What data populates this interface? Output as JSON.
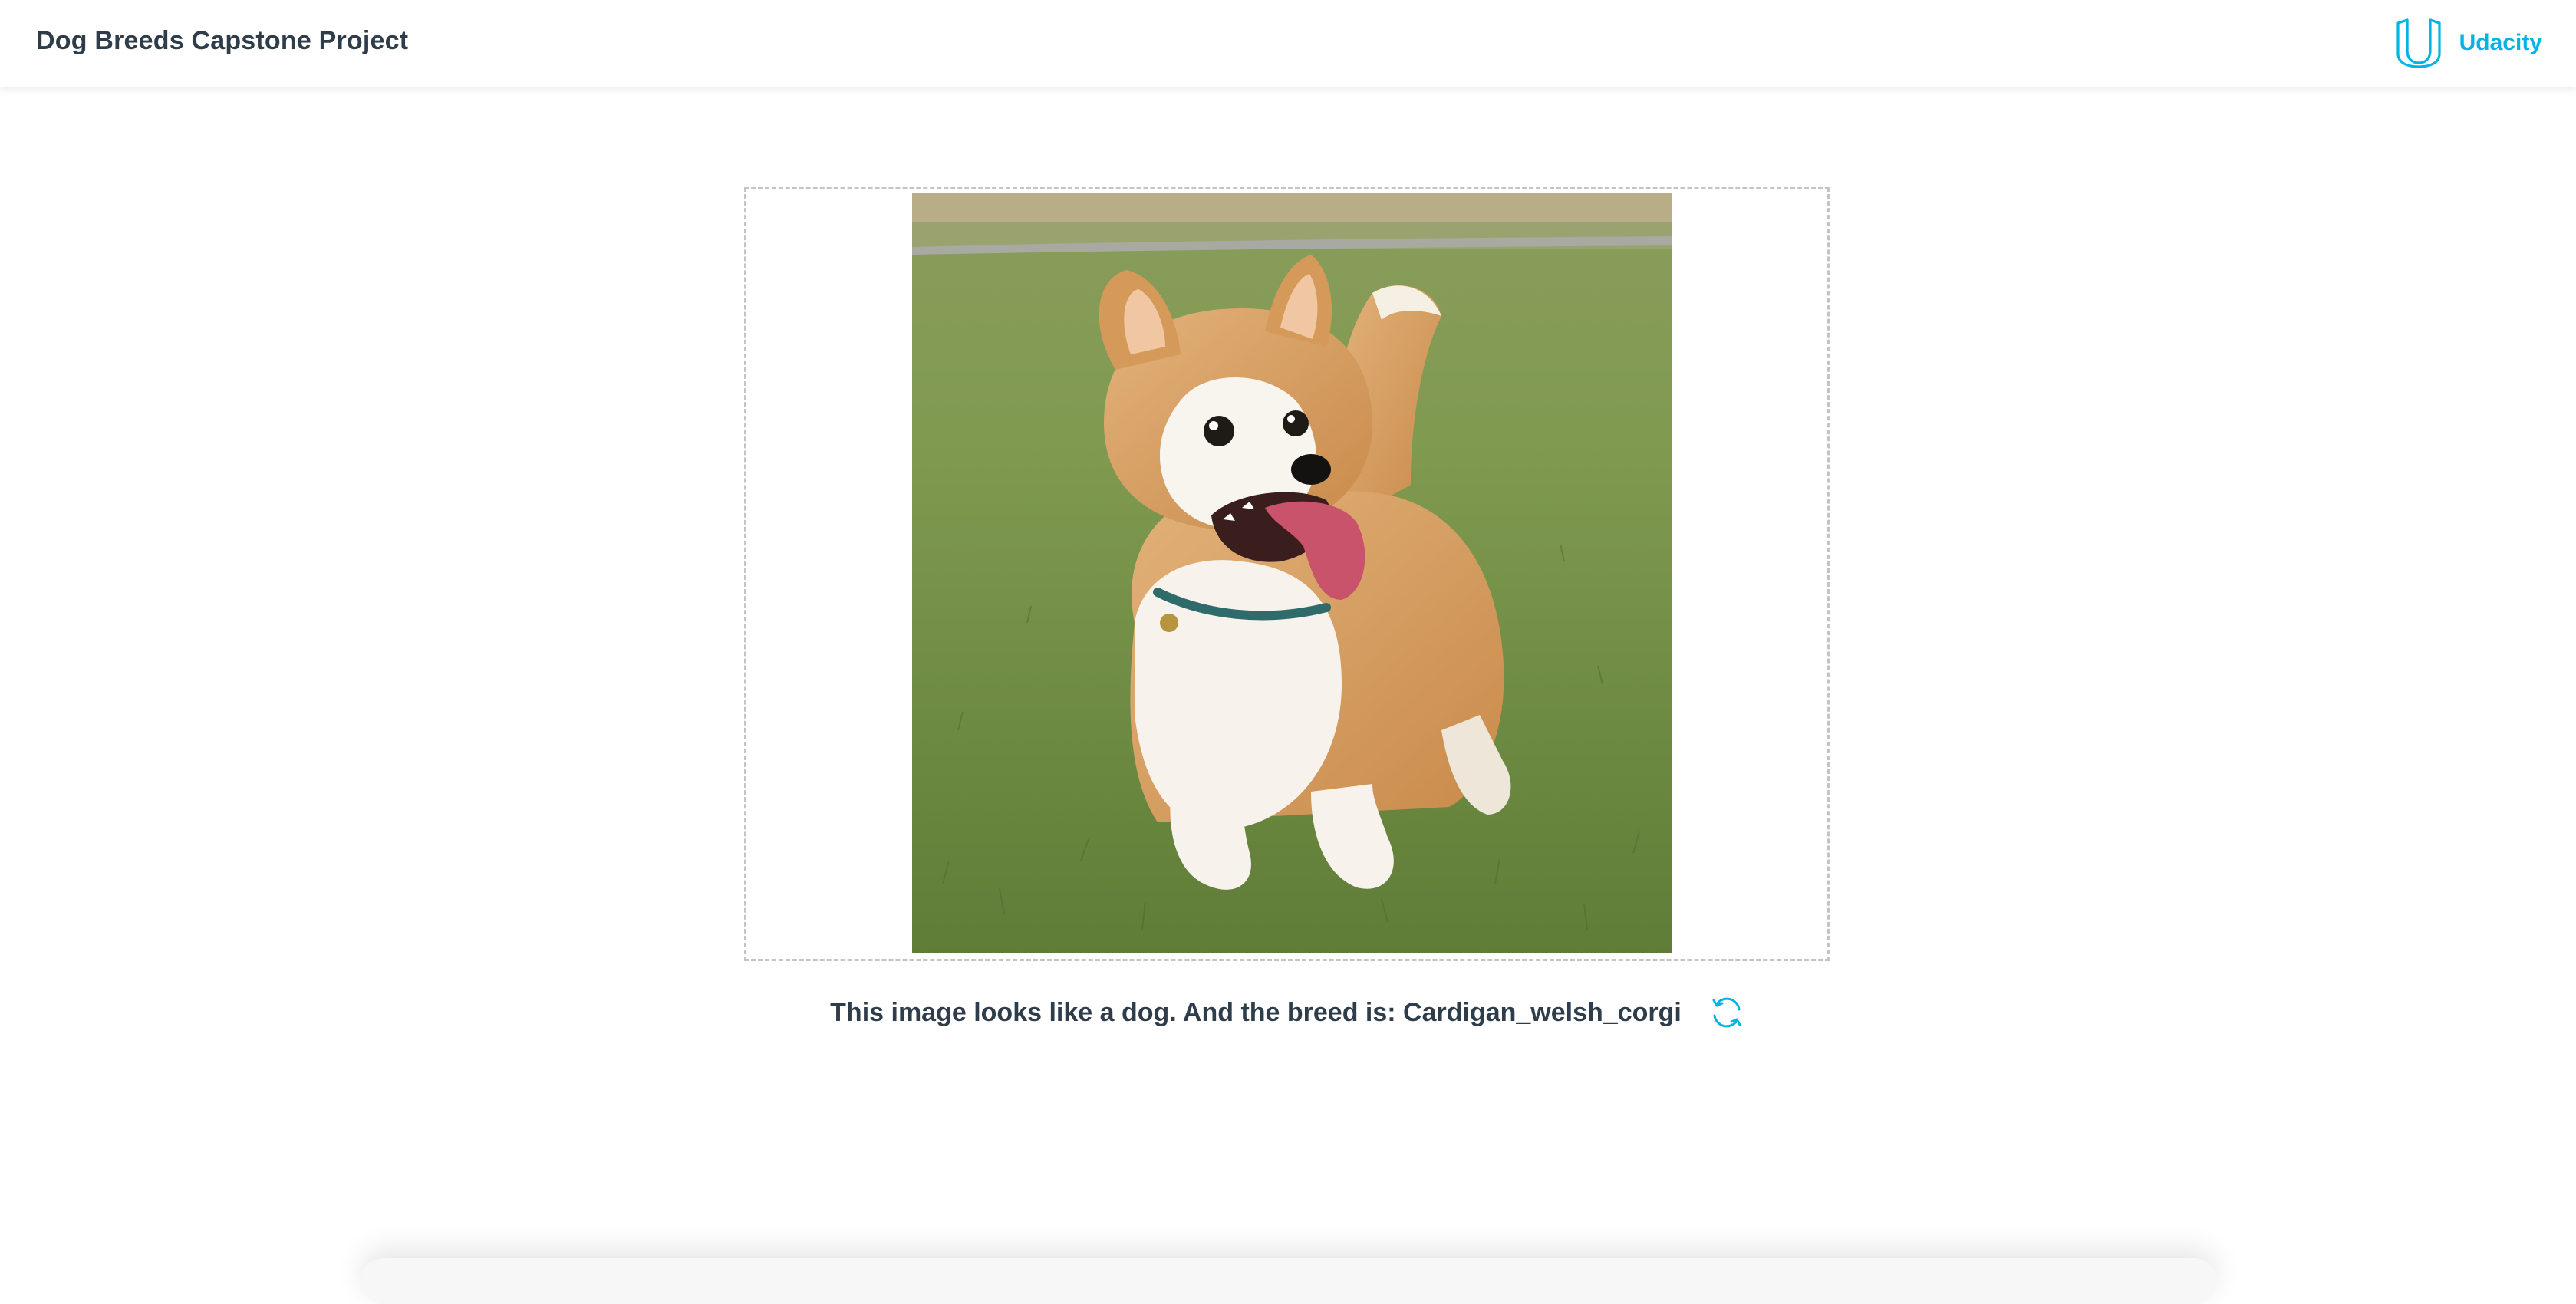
{
  "header": {
    "title": "Dog Breeds Capstone Project",
    "brand_name": "Udacity",
    "brand_icon": "udacity-logo-icon",
    "brand_color": "#02b3e4"
  },
  "upload": {
    "image_alt": "Cardigan Welsh Corgi running on grass",
    "border_color": "#c4c4c4"
  },
  "result": {
    "text": "This image looks like a dog. And the breed is: Cardigan_welsh_corgi",
    "refresh_icon": "refresh-icon"
  }
}
